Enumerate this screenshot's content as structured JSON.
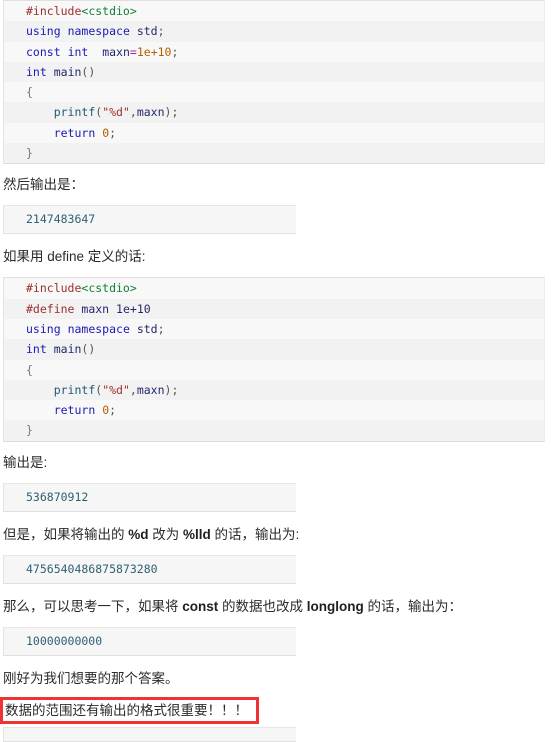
{
  "document": {
    "language": "C++",
    "accent_red": "#ef3232",
    "code_bg": "#f8f8f8",
    "code_bg_alt": "#f2f2f2",
    "output_bg": "#f6f6f6",
    "output_text_color": "#2e6173"
  },
  "code_block_1": {
    "lines": [
      "#include<cstdio>",
      "using namespace std;",
      "const int  maxn=1e+10;",
      "int main()",
      "{",
      "    printf(\"%d\",maxn);",
      "    return 0;",
      "}"
    ]
  },
  "paragraph_1": {
    "text": "然后输出是："
  },
  "output_1": {
    "value": "2147483647"
  },
  "paragraph_2": {
    "text": "如果用 define 定义的话:"
  },
  "code_block_2": {
    "lines": [
      "#include<cstdio>",
      "#define maxn 1e+10",
      "using namespace std;",
      "int main()",
      "{",
      "    printf(\"%d\",maxn);",
      "    return 0;",
      "}"
    ]
  },
  "paragraph_3": {
    "text": "输出是:"
  },
  "output_2": {
    "value": "536870912"
  },
  "paragraph_4": {
    "prefix": "但是，如果将输出的 ",
    "bold_1": "%d",
    "middle": " 改为 ",
    "bold_2": "%lld",
    "suffix": " 的话，输出为:"
  },
  "output_3": {
    "value": "4756540486875873280"
  },
  "paragraph_5": {
    "prefix": "那么，可以思考一下，如果将 ",
    "bold_1": "const",
    "middle": " 的数据也改成 ",
    "bold_2": "longlong",
    "suffix": " 的话，输出为："
  },
  "output_4": {
    "value": "10000000000"
  },
  "paragraph_6": {
    "text": "刚好为我们想要的那个答案。"
  },
  "highlight_note": {
    "text": "数据的范围还有输出的格式很重要！！！"
  },
  "output_5": {
    "value": ""
  }
}
